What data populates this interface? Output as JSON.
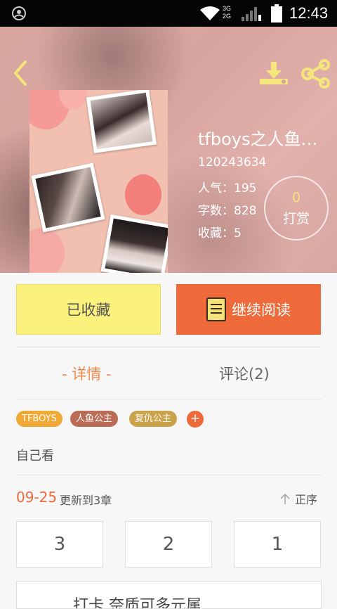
{
  "status_bar": {
    "time": "12:43",
    "net_top": "3G",
    "net_bottom": "2G"
  },
  "header": {
    "back_icon": "chevron-left-icon",
    "download_icon": "download-icon",
    "share_icon": "share-icon",
    "icon_color": "#f4e57c"
  },
  "book": {
    "title": "tfboys之人鱼…",
    "id": "120243634",
    "popularity": "人气：195",
    "word_count": "字数：828",
    "favorites": "收藏：5",
    "reward_count": "0",
    "reward_label": "打赏"
  },
  "actions": {
    "collected_label": "已收藏",
    "continue_label": "继续阅读"
  },
  "tabs": [
    {
      "label": "- 详情 -"
    },
    {
      "label": "评论(2)"
    }
  ],
  "tags": [
    {
      "label": "TFBOYS",
      "color": "#f0a934"
    },
    {
      "label": "人鱼公主",
      "color": "#bb6c56"
    },
    {
      "label": "复仇公主",
      "color": "#caa24a"
    }
  ],
  "add_tag": "+",
  "description": "自己看",
  "update": {
    "date": "09-25",
    "text": "更新到3章",
    "sort_label": "正序"
  },
  "chapters": [
    {
      "label": "3"
    },
    {
      "label": "2"
    },
    {
      "label": "1"
    }
  ],
  "bottom_text": "打卡   奈质可多元属"
}
